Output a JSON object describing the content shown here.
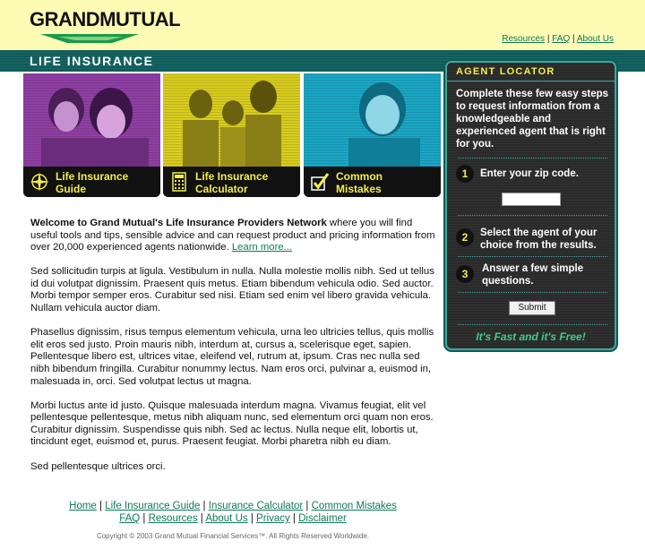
{
  "header": {
    "logo_text": "GRANDMUTUAL",
    "logo_tm": "™",
    "links": [
      "Resources",
      "FAQ",
      "About Us"
    ],
    "section_title": "LIFE INSURANCE"
  },
  "tiles": [
    {
      "label_line1": "Life Insurance",
      "label_line2": "Guide",
      "icon": "compass-icon"
    },
    {
      "label_line1": "Life Insurance",
      "label_line2": "Calculator",
      "icon": "calculator-icon"
    },
    {
      "label_line1": "Common",
      "label_line2": "Mistakes",
      "icon": "checkmark-icon"
    }
  ],
  "agent_locator": {
    "title": "AGENT LOCATOR",
    "intro": "Complete these few easy steps to request information from a knowledgeable and experienced agent that is right for you.",
    "steps": [
      {
        "num": "1",
        "text": "Enter your zip code."
      },
      {
        "num": "2",
        "text": "Select the agent of your choice from the results."
      },
      {
        "num": "3",
        "text": "Answer a few simple questions."
      }
    ],
    "zip_value": "",
    "submit_label": "Submit",
    "tagline": "It's Fast and it's Free!"
  },
  "main": {
    "intro_bold": "Welcome to Grand Mutual's Life Insurance Providers Network",
    "intro_rest": " where you will find useful tools and tips, sensible advice and can request product and pricing information from over 20,000 experienced agents nationwide. ",
    "learn_more": "Learn more...",
    "p2": "Sed sollicitudin turpis at ligula. Vestibulum in nulla. Nulla molestie mollis nibh. Sed ut tellus id dui volutpat dignissim. Praesent quis metus. Etiam bibendum vehicula odio. Sed auctor. Morbi tempor semper eros. Curabitur sed nisi. Etiam sed enim vel libero gravida vehicula. Nullam vehicula auctor diam.",
    "p3": "Phasellus dignissim, risus tempus elementum vehicula, urna leo ultricies tellus, quis mollis elit eros sed justo. Proin mauris nibh, interdum at, cursus a, scelerisque eget, sapien. Pellentesque libero est, ultrices vitae, eleifend vel, rutrum at, ipsum. Cras nec nulla sed nibh bibendum fringilla. Curabitur nonummy lectus. Nam eros orci, pulvinar a, euismod in, malesuada in, orci. Sed volutpat lectus ut magna.",
    "p4": "Morbi luctus ante id justo. Quisque malesuada interdum magna. Vivamus feugiat, elit vel pellentesque pellentesque, metus nibh aliquam nunc, sed elementum orci quam non eros. Curabitur dignissim. Suspendisse quis nibh. Sed ac lectus. Nulla neque elit, lobortis ut, tincidunt eget, euismod et, purus. Praesent feugiat. Morbi pharetra nibh eu diam.",
    "p5": "Sed pellentesque ultrices orci."
  },
  "footer": {
    "row1": [
      "Home",
      "Life Insurance Guide",
      "Insurance Calculator",
      "Common Mistakes"
    ],
    "row2": [
      "FAQ",
      "Resources",
      "About Us",
      "Privacy",
      "Disclaimer"
    ],
    "copyright": "Copyright © 2003 Grand Mutual Financial Services™. All Rights Reserved Worldwide."
  },
  "colors": {
    "header_bg": "#fefcb4",
    "band": "#0d5c5a",
    "link": "#0e7a55",
    "accent_yellow": "#f3ee4a",
    "tagline_green": "#3ccf8e"
  }
}
